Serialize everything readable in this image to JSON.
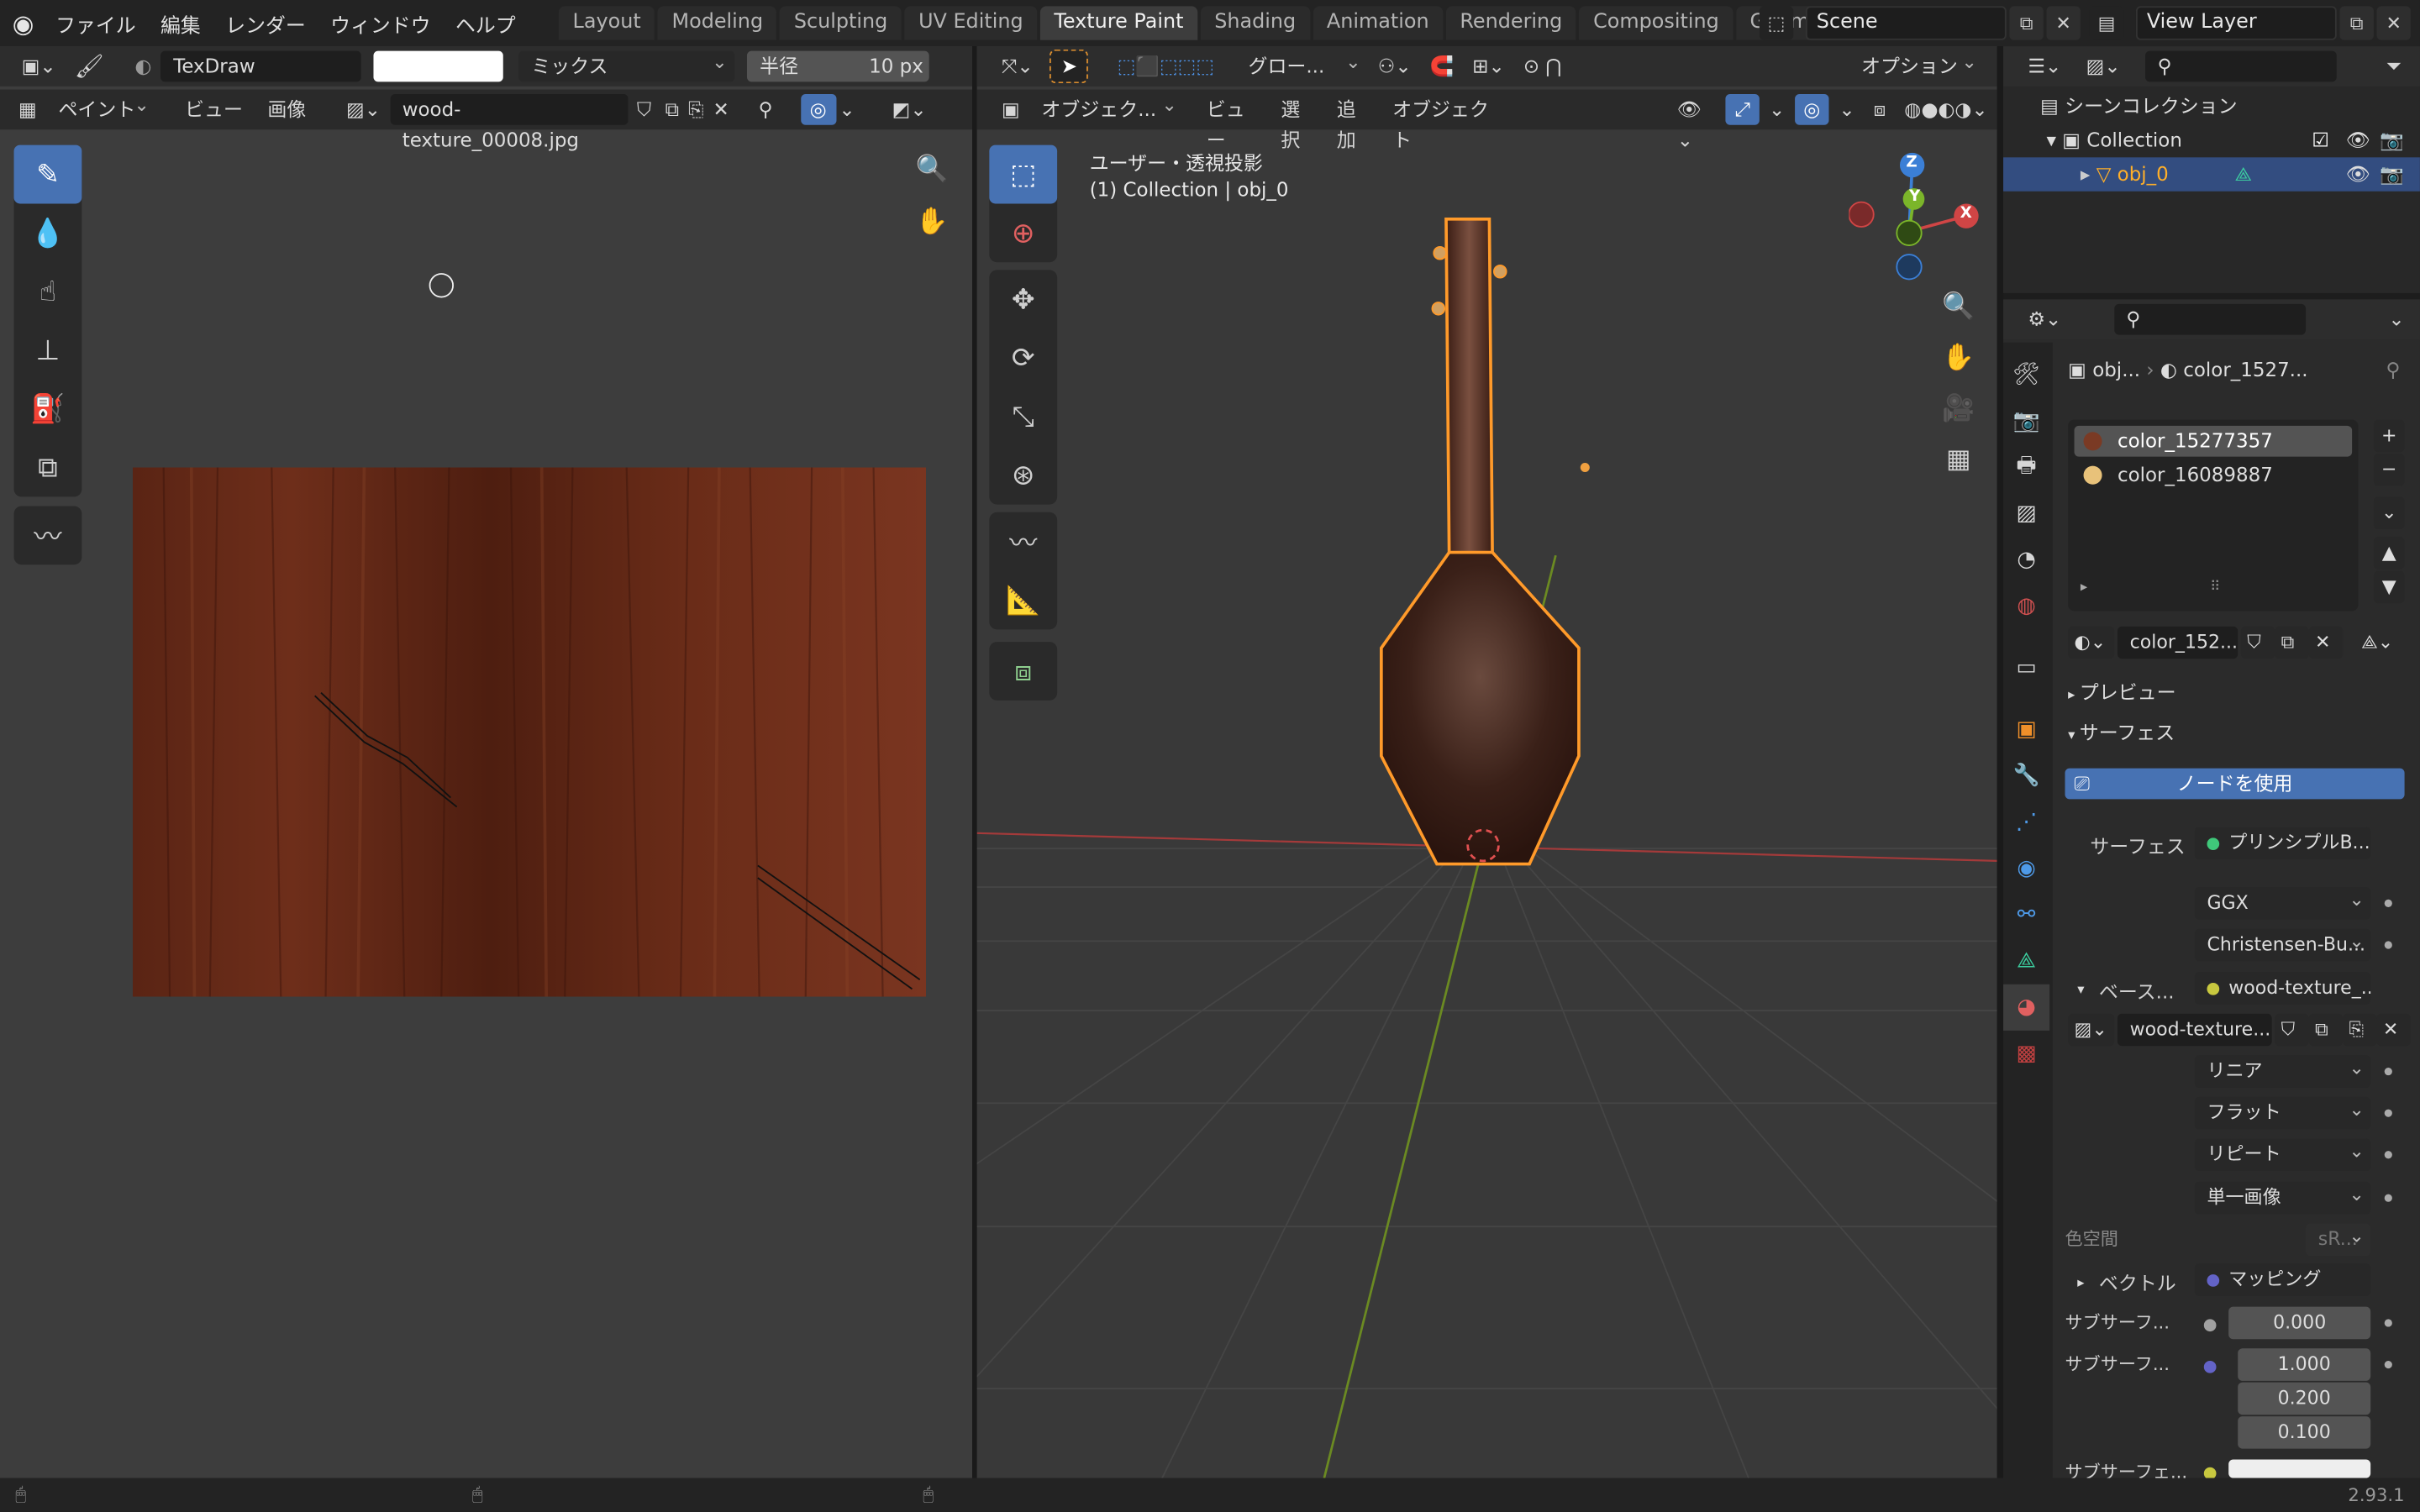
{
  "menu": [
    "ファイル",
    "編集",
    "レンダー",
    "ウィンドウ",
    "ヘルプ"
  ],
  "workspaces": [
    "Layout",
    "Modeling",
    "Sculpting",
    "UV Editing",
    "Texture Paint",
    "Shading",
    "Animation",
    "Rendering",
    "Compositing",
    "Geometry"
  ],
  "active_workspace": "Texture Paint",
  "scene": "Scene",
  "view_layer": "View Layer",
  "image_editor": {
    "brush": "TexDraw",
    "blend": "ミックス",
    "radius_label": "半径",
    "radius_value": "10 px",
    "mode": "ペイント",
    "menu_view": "ビュー",
    "menu_image": "画像",
    "image_name": "wood-texture_00008.jpg"
  },
  "viewport": {
    "mode": "オブジェク...",
    "menus": [
      "ビュー",
      "選択",
      "追加",
      "オブジェクト"
    ],
    "transform": "グロー...",
    "options": "オプション",
    "view_name": "ユーザー・透視投影",
    "collection_info": "(1) Collection | obj_0",
    "axes": {
      "z": "Z",
      "y": "Y",
      "x": "X"
    }
  },
  "outliner": {
    "scene_collection": "シーンコレクション",
    "collection": "Collection",
    "object": "obj_0"
  },
  "properties": {
    "breadcrumb_obj": "obj...",
    "breadcrumb_mat": "color_1527...",
    "materials": [
      "color_15277357",
      "color_16089887"
    ],
    "material_field": "color_152...",
    "preview": "プレビュー",
    "surface_panel": "サーフェス",
    "use_nodes": "ノードを使用",
    "surface_label": "サーフェス",
    "surface_value": "プリンシプルB...",
    "ggx": "GGX",
    "sss_method": "Christensen-Bu...",
    "base_label": "ベース...",
    "base_value": "wood-texture_...",
    "image_field": "wood-texture...",
    "interp": "リニア",
    "projection": "フラット",
    "extension": "リピート",
    "source": "単一画像",
    "colorspace_label": "色空間",
    "colorspace_value": "sR...",
    "vector_label": "ベクトル",
    "vector_value": "マッピング",
    "sub1_label": "サブサーフ...",
    "sub1_value": "0.000",
    "sub2_label": "サブサーフ...",
    "sub2_values": [
      "1.000",
      "0.200",
      "0.100"
    ],
    "sub3_label": "サブサーフェ..."
  },
  "version": "2.93.1"
}
